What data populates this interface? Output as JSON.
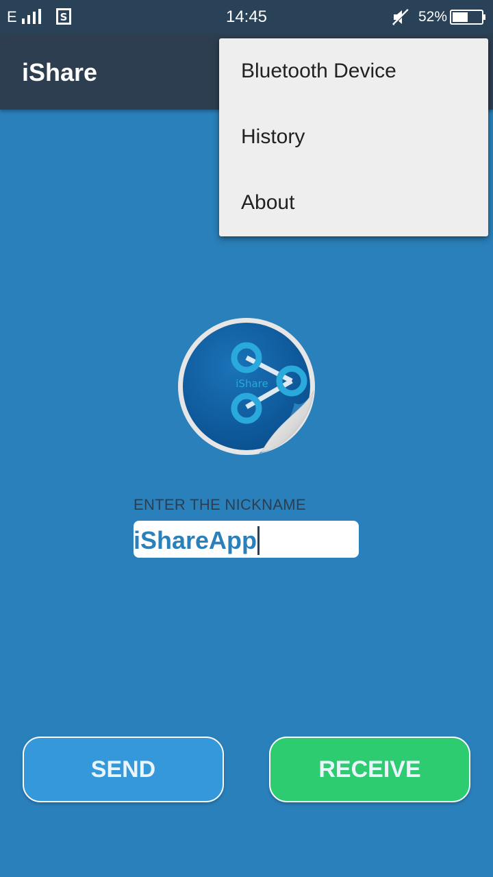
{
  "status_bar": {
    "network_type": "E",
    "time": "14:45",
    "battery_percent": "52%",
    "icons": [
      "signal-icon",
      "sim-icon",
      "mute-icon",
      "battery-icon"
    ]
  },
  "app_bar": {
    "title": "iShare"
  },
  "overflow_menu": {
    "items": [
      {
        "label": "Bluetooth Device"
      },
      {
        "label": "History"
      },
      {
        "label": "About"
      }
    ]
  },
  "logo": {
    "text": "iShare",
    "icon": "share-icon"
  },
  "nickname": {
    "label": "ENTER THE NICKNAME",
    "value": "iShareApp"
  },
  "actions": {
    "send_label": "SEND",
    "receive_label": "RECEIVE"
  },
  "colors": {
    "background": "#2a80bb",
    "app_bar": "#2c3e50",
    "status_bar": "#294258",
    "send": "#3498db",
    "receive": "#2ecc71",
    "menu": "#eeeeee"
  }
}
